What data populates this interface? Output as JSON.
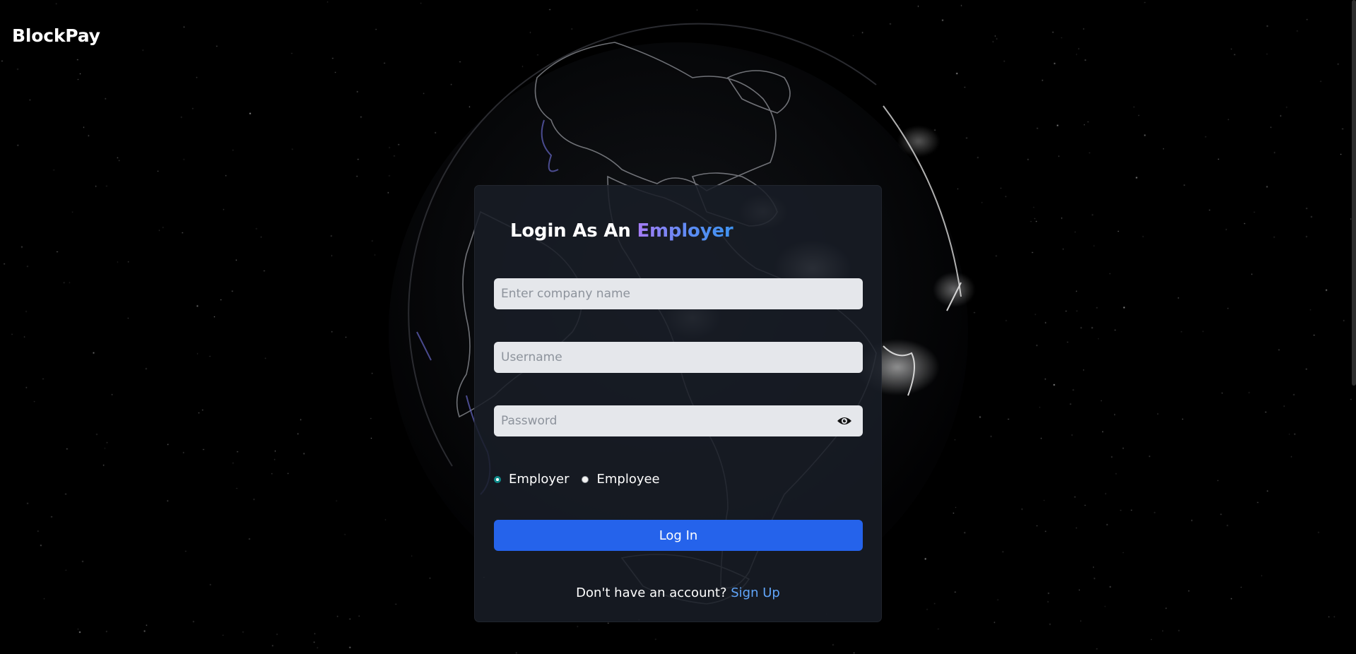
{
  "brand": {
    "name": "BlockPay"
  },
  "login": {
    "title_prefix": "Login As An",
    "title_role": "Employer",
    "company_placeholder": "Enter company name",
    "username_placeholder": "Username",
    "password_placeholder": "Password",
    "roles": [
      {
        "label": "Employer",
        "selected": true
      },
      {
        "label": "Employee",
        "selected": false
      }
    ],
    "submit_label": "Log In",
    "signup_prompt": "Don't have an account?",
    "signup_link": "Sign Up"
  },
  "icons": {
    "password_toggle": "eye-icon"
  },
  "colors": {
    "background": "#000000",
    "card": "#181d26",
    "input_bg": "#e5e7eb",
    "primary_button": "#2563eb",
    "link": "#60a5fa",
    "title_gradient_start": "#a77cf6",
    "title_gradient_end": "#3f93f0",
    "radio_checked": "#0e8a8a"
  }
}
